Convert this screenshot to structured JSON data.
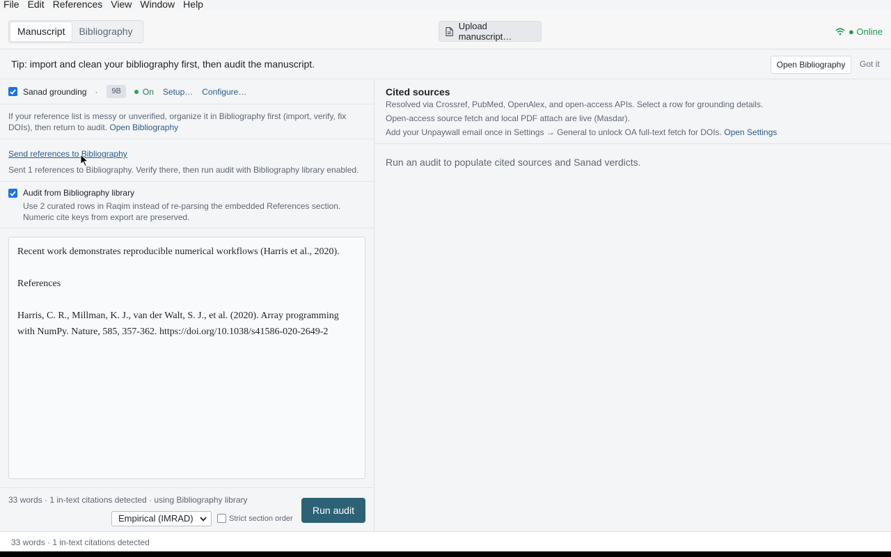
{
  "menubar": {
    "items": [
      "File",
      "Edit",
      "References",
      "View",
      "Window",
      "Help"
    ]
  },
  "header": {
    "tabs": [
      {
        "label": "Manuscript",
        "active": true
      },
      {
        "label": "Bibliography",
        "active": false
      }
    ],
    "upload_label": "Upload manuscript…",
    "upload_icon": "document-icon",
    "status_label": "● Online",
    "status_icon": "wifi-icon",
    "status_color": "#1a9a4a"
  },
  "tip": {
    "text": "Tip: import and clean your bibliography first, then audit the manuscript.",
    "open_bibliography_label": "Open Bibliography",
    "dismiss_label": "Got it"
  },
  "grounding": {
    "checked": true,
    "label": "Sanad grounding",
    "separator": "·",
    "model_badge": "9B",
    "state_label": "On",
    "state_color": "#22a55a",
    "setup_label": "Setup…",
    "configure_label": "Configure…"
  },
  "info": {
    "message": "If your reference list is messy or unverified, organize it in Bibliography first (import, verify, fix DOIs), then return to audit. ",
    "link_label": "Open Bibliography"
  },
  "send": {
    "link_label": "Send references to Bibliography",
    "result_text": "Sent 1 references to Bibliography. Verify there, then run audit with Bibliography library enabled."
  },
  "audit_library": {
    "checked": true,
    "label": "Audit from Bibliography library",
    "description": "Use 2 curated rows in Raqim instead of re-parsing the embedded References section. Numeric cite keys from export are preserved."
  },
  "editor": {
    "paragraph1": "Recent work demonstrates reproducible numerical workflows (Harris et al., 2020).",
    "heading": "References",
    "reference1": "Harris, C. R., Millman, K. J., van der Walt, S. J., et al. (2020). Array programming with NumPy. Nature, 585, 357-362. https://doi.org/10.1038/s41586-020-2649-2"
  },
  "left_footer": {
    "stats": "33 words · 1 in-text citations detected · using Bibliography library",
    "template_select": "Empirical (IMRAD)",
    "strict_label": "Strict section order",
    "strict_checked": false,
    "run_label": "Run audit",
    "run_color": "#2d6276"
  },
  "cited": {
    "title": "Cited sources",
    "line1": "Resolved via Crossref, PubMed, OpenAlex, and open-access APIs. Select a row for grounding details.",
    "line2": "Open-access source fetch and local PDF attach are live (Masdar).",
    "line3": "Add your Unpaywall email once in Settings → General to unlock OA full-text fetch for DOIs. ",
    "line3_link": "Open Settings",
    "empty_state": "Run an audit to populate cited sources and Sanad verdicts."
  },
  "statusbar": {
    "text": "33 words · 1 in-text citations detected"
  }
}
